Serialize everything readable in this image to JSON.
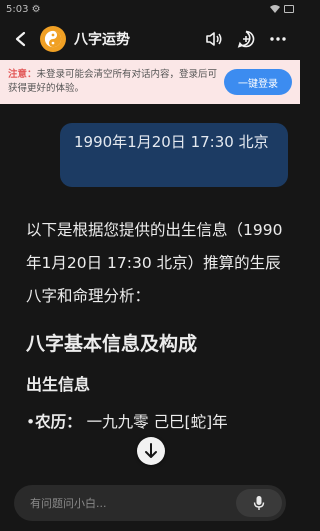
{
  "status_bar": {
    "time": "5:03 ⚙"
  },
  "header": {
    "back_icon": "back-arrow-icon",
    "title": "八字运势",
    "avatar_icon": "yin-yang-icon",
    "actions": [
      "speaker-icon",
      "add-chat-icon",
      "more-icon"
    ]
  },
  "notice": {
    "label": "注意：",
    "text": "未登录可能会清空所有对话内容，登录后可获得更好的体验。",
    "login_button": "一键登录",
    "colors": {
      "background": "#fbe7e7",
      "label": "#e25757",
      "button": "#3c8cf0"
    }
  },
  "conversation": {
    "user_message": "1990年1月20日 17:30 北京",
    "assistant": {
      "intro": "以下是根据您提供的出生信息（1990年1月20日 17:30 北京）推算的生辰八字和命理分析：",
      "section_title": "八字基本信息及构成",
      "sub_title": "出生信息",
      "bullet_label": "农历：",
      "bullet_value": "一九九零 己巳[蛇]年"
    }
  },
  "input": {
    "placeholder": "有问题问小白...",
    "mic_icon": "microphone-icon"
  },
  "scroll_down_icon": "arrow-down-icon"
}
